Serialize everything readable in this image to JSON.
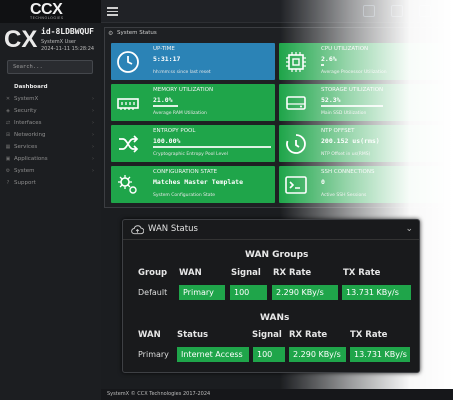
{
  "brand": {
    "logo": "CCX",
    "tagline": "TECHNOLOGIES",
    "device_logo": "CX"
  },
  "device": {
    "id": "id-8LDBWQUF",
    "user": "SystemX User",
    "time": "2024-11-11 15:28:24"
  },
  "search": {
    "placeholder": "Search..."
  },
  "nav": {
    "items": [
      {
        "label": "Dashboard",
        "icon": "dashboard-icon",
        "active": true
      },
      {
        "label": "SystemX",
        "icon": "systemx-icon",
        "has_children": true
      },
      {
        "label": "Security",
        "icon": "shield-icon",
        "has_children": true
      },
      {
        "label": "Interfaces",
        "icon": "interfaces-icon",
        "has_children": true
      },
      {
        "label": "Networking",
        "icon": "network-icon",
        "has_children": true
      },
      {
        "label": "Services",
        "icon": "services-icon",
        "has_children": true
      },
      {
        "label": "Applications",
        "icon": "apps-icon",
        "has_children": true
      },
      {
        "label": "System",
        "icon": "system-icon",
        "has_children": true
      },
      {
        "label": "Support",
        "icon": "support-icon"
      }
    ]
  },
  "status": {
    "title": "System Status",
    "tiles": [
      {
        "title": "UP-TIME",
        "value": "5:31:17",
        "sub": "hh:mm:ss since last reset",
        "color": "#2b83b6",
        "icon": "clock-icon"
      },
      {
        "title": "CPU UTILIZATION",
        "value": "2.6%",
        "sub": "Average Processor Utilization",
        "color": "#1fa54a",
        "icon": "cpu-icon",
        "fill": 0.026
      },
      {
        "title": "MEMORY UTILIZATION",
        "value": "21.0%",
        "sub": "Average RAM Utilization",
        "color": "#1fa54a",
        "icon": "memory-icon",
        "fill": 0.21
      },
      {
        "title": "STORAGE UTILIZATION",
        "value": "52.3%",
        "sub": "Main SSD Utilization",
        "color": "#1fa54a",
        "icon": "storage-icon",
        "fill": 0.523
      },
      {
        "title": "ENTROPY POOL",
        "value": "100.00%",
        "sub": "Cryptographic Entropy Pool Level",
        "color": "#1fa54a",
        "icon": "shuffle-icon",
        "fill": 1.0
      },
      {
        "title": "NTP OFFSET",
        "value": "200.152 us(rms)",
        "sub": "NTP Offset in us(RMS)",
        "color": "#1fa54a",
        "icon": "timer-icon"
      },
      {
        "title": "CONFIGURATION STATE",
        "value": "Matches Master Template",
        "sub": "System Configuration State",
        "color": "#1fa54a",
        "icon": "gears-icon"
      },
      {
        "title": "SSH CONNECTIONS",
        "value": "0",
        "sub": "Active SSH Sessions",
        "color": "#1fa54a",
        "icon": "terminal-icon"
      }
    ]
  },
  "wan": {
    "title": "WAN Status",
    "groups": {
      "title": "WAN Groups",
      "headers": [
        "Group",
        "WAN",
        "Signal",
        "RX Rate",
        "TX Rate"
      ],
      "row": {
        "group": "Default",
        "wan": "Primary",
        "signal": "100",
        "rx": "2.290 KBy/s",
        "tx": "13.731 KBy/s"
      }
    },
    "wans": {
      "title": "WANs",
      "headers": [
        "WAN",
        "Status",
        "Signal",
        "RX Rate",
        "TX Rate"
      ],
      "row": {
        "wan": "Primary",
        "status": "Internet Access",
        "signal": "100",
        "rx": "2.290 KBy/s",
        "tx": "13.731 KBy/s"
      }
    }
  },
  "footer": {
    "text": "SystemX © CCX Technologies 2017-2024"
  }
}
